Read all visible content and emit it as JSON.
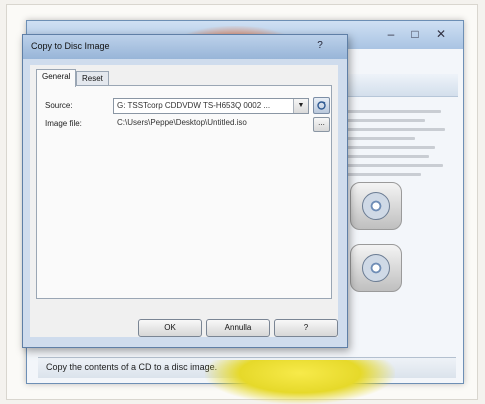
{
  "background_window": {
    "status_text": "Copy the contents of a CD to a disc image."
  },
  "dialog": {
    "title": "Copy to Disc Image",
    "help_glyph": "?",
    "tabs": [
      {
        "label": "General"
      },
      {
        "label": "Reset"
      }
    ],
    "source": {
      "label": "Source:",
      "value": "G: TSSTcorp CDDVDW TS-H653Q 0002 ..."
    },
    "image_file": {
      "label": "Image file:",
      "value": "C:\\Users\\Peppe\\Desktop\\Untitled.iso",
      "browse_label": "..."
    },
    "buttons": {
      "ok": "OK",
      "cancel": "Annulla",
      "help": "?"
    }
  },
  "colors": {
    "window_frame": "#6d8fb5",
    "dialog_title_bar": "#98b5d8",
    "accent_orange": "#e9743f",
    "accent_yellow": "#f7ea4a"
  }
}
